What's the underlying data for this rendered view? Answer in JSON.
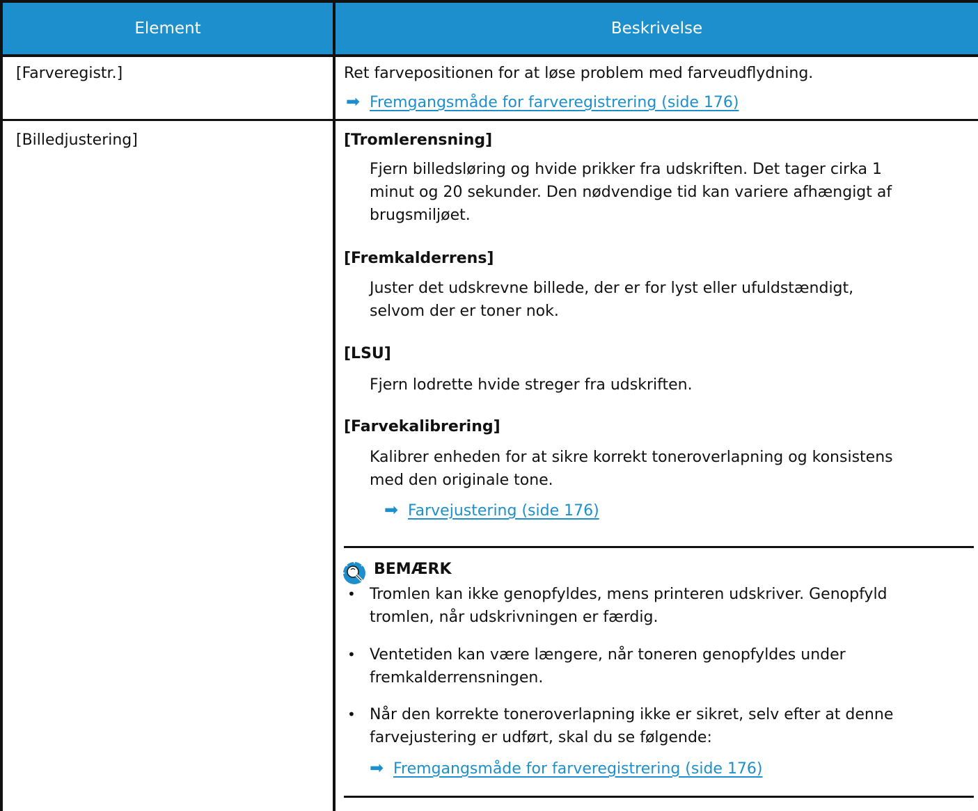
{
  "table": {
    "headers": {
      "element": "Element",
      "description": "Beskrivelse"
    },
    "rows": [
      {
        "element": "[Farveregistr.]",
        "description": "Ret farvepositionen for at løse problem med farveudflydning.",
        "link": "Fremgangsmåde for farveregistrering (side 176)"
      },
      {
        "element": "[Billedjustering]",
        "subsections": [
          {
            "title": "[Tromlerensning]",
            "lines": [
              "Fjern billedsløring og hvide prikker fra udskriften. Det tager cirka 1",
              "minut og 20 sekunder. Den nødvendige tid kan variere afhængigt af",
              "brugsmiljøet."
            ]
          },
          {
            "title": "[Fremkalderrens]",
            "lines": [
              "Juster det udskrevne billede, der er for lyst eller ufuldstændigt,",
              "selvom der er toner nok."
            ]
          },
          {
            "title": "[LSU]",
            "lines": [
              "Fjern lodrette hvide streger fra udskriften."
            ]
          },
          {
            "title": "[Farvekalibrering]",
            "lines": [
              "Kalibrer enheden for at sikre korrekt toneroverlapning og konsistens",
              "med den originale tone."
            ],
            "link": "Farvejustering (side 176)"
          }
        ],
        "note": {
          "title": "BEMÆRK",
          "icon": "lightbulb-note-icon",
          "items": [
            {
              "lines": [
                "Tromlen kan ikke genopfyldes, mens printeren udskriver. Genopfyld",
                "tromlen, når udskrivningen er færdig."
              ]
            },
            {
              "lines": [
                "Ventetiden kan være længere, når toneren genopfyldes under",
                "fremkalderrensningen."
              ]
            },
            {
              "lines": [
                "Når den korrekte toneroverlapning ikke er sikret, selv efter at denne",
                "farvejustering er udført, skal du se følgende:"
              ],
              "link": "Fremgangsmåde for farveregistrering (side 176)"
            }
          ]
        }
      }
    ]
  },
  "colors": {
    "header_bg": "#1d8fcc",
    "link": "#1d8fcc",
    "border": "#111111"
  }
}
